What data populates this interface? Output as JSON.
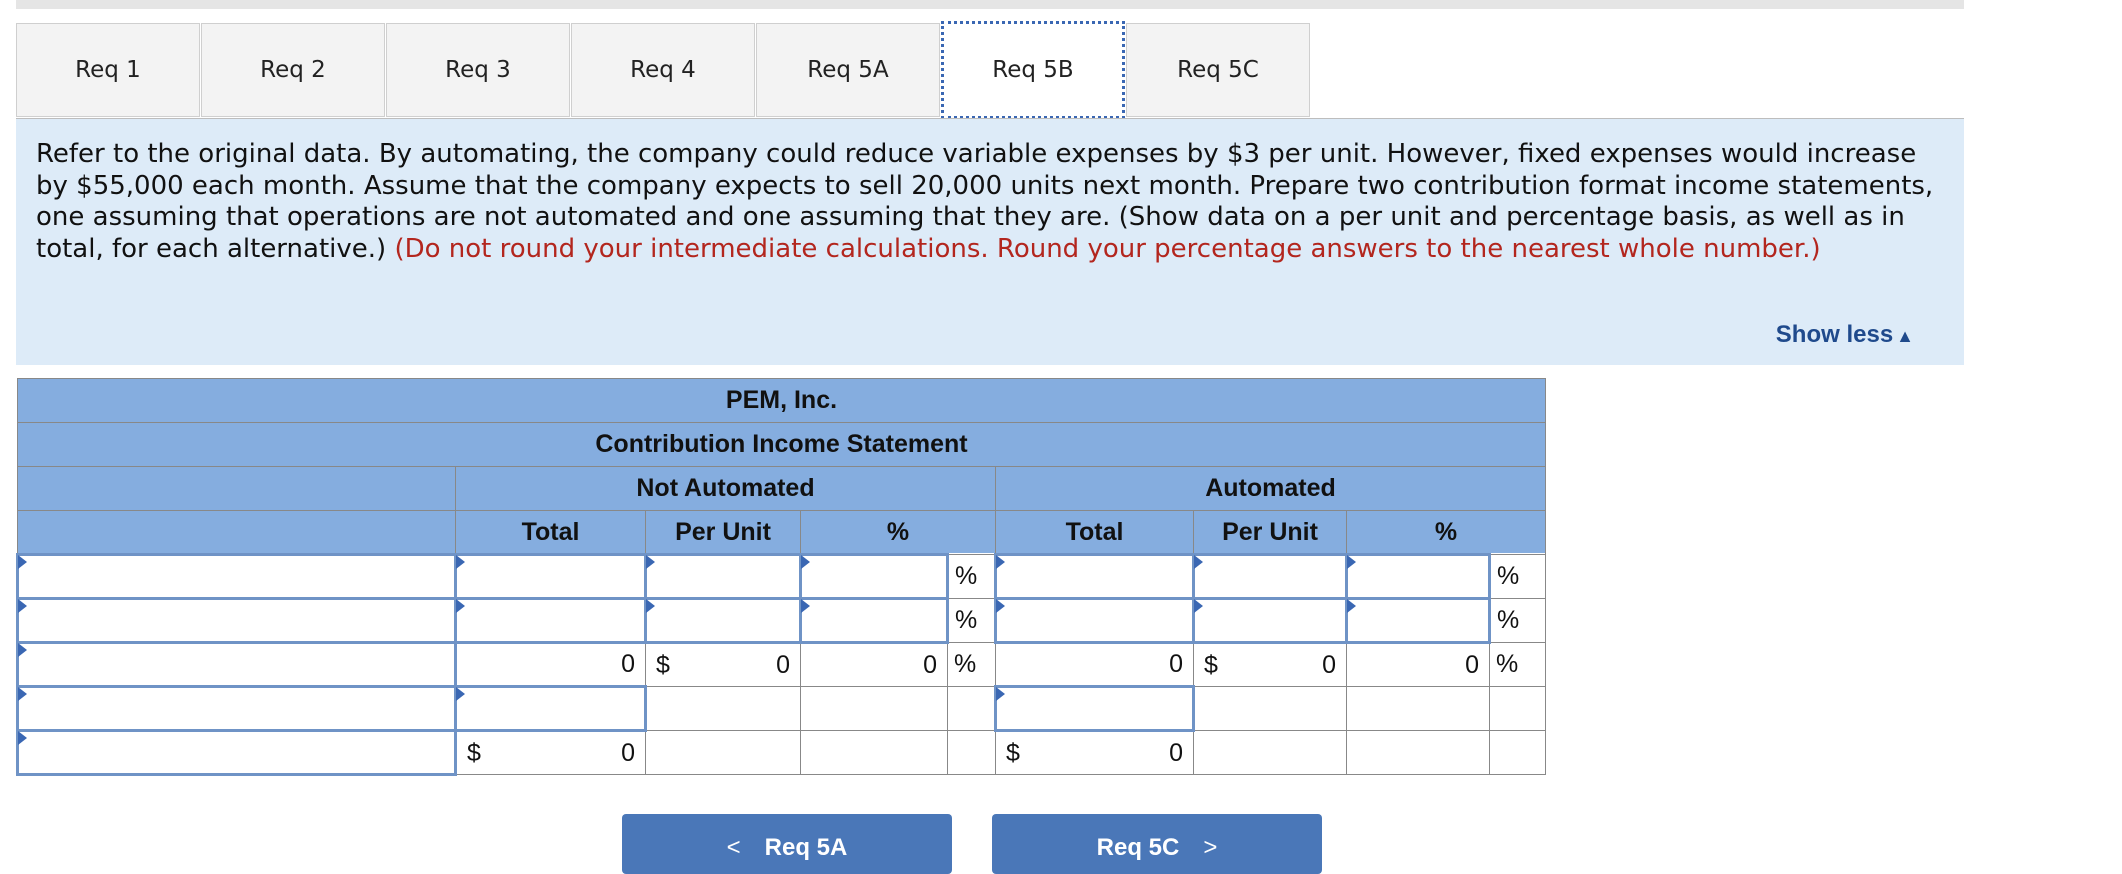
{
  "tabs": [
    {
      "label": "Req 1",
      "active": false
    },
    {
      "label": "Req 2",
      "active": false
    },
    {
      "label": "Req 3",
      "active": false
    },
    {
      "label": "Req 4",
      "active": false
    },
    {
      "label": "Req 5A",
      "active": false
    },
    {
      "label": "Req 5B",
      "active": true
    },
    {
      "label": "Req 5C",
      "active": false
    }
  ],
  "instructions": {
    "text": "Refer to the original data. By automating, the company could reduce variable expenses by $3 per unit. However, fixed expenses would increase by $55,000 each month. Assume that the company expects to sell 20,000 units next month. Prepare two contribution format income statements, one assuming that operations are not automated and one assuming that they are. (Show data on a per unit and percentage basis, as well as in total, for each alternative.)",
    "note": "(Do not round your intermediate calculations. Round your percentage answers to the nearest whole number.)",
    "show_less": "Show less"
  },
  "statement": {
    "company": "PEM, Inc.",
    "title": "Contribution Income Statement",
    "groups": [
      "Not Automated",
      "Automated"
    ],
    "columns": [
      "Total",
      "Per Unit",
      "%"
    ],
    "pct_symbol": "%",
    "currency": "$",
    "zero": "0"
  },
  "nav": {
    "prev": "Req 5A",
    "next": "Req 5C",
    "prev_arrow": "<",
    "next_arrow": ">"
  }
}
